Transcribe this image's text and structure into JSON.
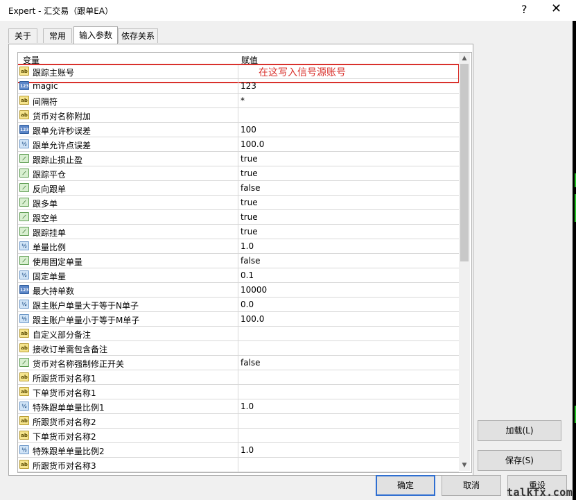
{
  "window": {
    "title": "Expert - 汇交易（跟单EA）",
    "help": "?",
    "close": "✕"
  },
  "tabs": [
    {
      "label": "关于"
    },
    {
      "label": "常用"
    },
    {
      "label": "输入参数"
    },
    {
      "label": "依存关系"
    }
  ],
  "grid": {
    "col_name": "变量",
    "col_value": "赋值",
    "rows": [
      {
        "name": "跟踪主账号",
        "type": "ab",
        "value": ""
      },
      {
        "name": "magic",
        "type": "int",
        "value": "123"
      },
      {
        "name": "间隔符",
        "type": "ab",
        "value": "*"
      },
      {
        "name": "货币对名称附加",
        "type": "ab",
        "value": ""
      },
      {
        "name": "跟单允许秒误差",
        "type": "int",
        "value": "100"
      },
      {
        "name": "跟单允许点误差",
        "type": "dbl",
        "value": "100.0"
      },
      {
        "name": "跟踪止损止盈",
        "type": "bool",
        "value": "true"
      },
      {
        "name": "跟踪平仓",
        "type": "bool",
        "value": "true"
      },
      {
        "name": "反向跟单",
        "type": "bool",
        "value": "false"
      },
      {
        "name": "跟多单",
        "type": "bool",
        "value": "true"
      },
      {
        "name": "跟空单",
        "type": "bool",
        "value": "true"
      },
      {
        "name": "跟踪挂单",
        "type": "bool",
        "value": "true"
      },
      {
        "name": "单量比例",
        "type": "dbl",
        "value": "1.0"
      },
      {
        "name": "使用固定单量",
        "type": "bool",
        "value": "false"
      },
      {
        "name": "固定单量",
        "type": "dbl",
        "value": "0.1"
      },
      {
        "name": "最大持单数",
        "type": "int",
        "value": "10000"
      },
      {
        "name": "跟主账户单量大于等于N单子",
        "type": "dbl",
        "value": "0.0"
      },
      {
        "name": "跟主账户单量小于等于M单子",
        "type": "dbl",
        "value": "100.0"
      },
      {
        "name": "自定义部分备注",
        "type": "ab",
        "value": ""
      },
      {
        "name": "接收订单需包含备注",
        "type": "ab",
        "value": ""
      },
      {
        "name": "货币对名称强制修正开关",
        "type": "bool",
        "value": "false"
      },
      {
        "name": "所跟货币对名称1",
        "type": "ab",
        "value": ""
      },
      {
        "name": "下单货币对名称1",
        "type": "ab",
        "value": ""
      },
      {
        "name": "特殊跟单单量比例1",
        "type": "dbl",
        "value": "1.0"
      },
      {
        "name": "所跟货币对名称2",
        "type": "ab",
        "value": ""
      },
      {
        "name": "下单货币对名称2",
        "type": "ab",
        "value": ""
      },
      {
        "name": "特殊跟单单量比例2",
        "type": "dbl",
        "value": "1.0"
      },
      {
        "name": "所跟货币对名称3",
        "type": "ab",
        "value": ""
      }
    ],
    "annotation": "在这写入信号源账号",
    "annotation_color": "#d9312c"
  },
  "icons": {
    "ab": "ab",
    "int": "123",
    "dbl": "½",
    "bool": "⟋"
  },
  "side_buttons": {
    "load": "加载(L)",
    "save": "保存(S)"
  },
  "footer": {
    "ok": "确定",
    "cancel": "取消",
    "reset": "重设"
  },
  "watermark": "talkfx.com"
}
